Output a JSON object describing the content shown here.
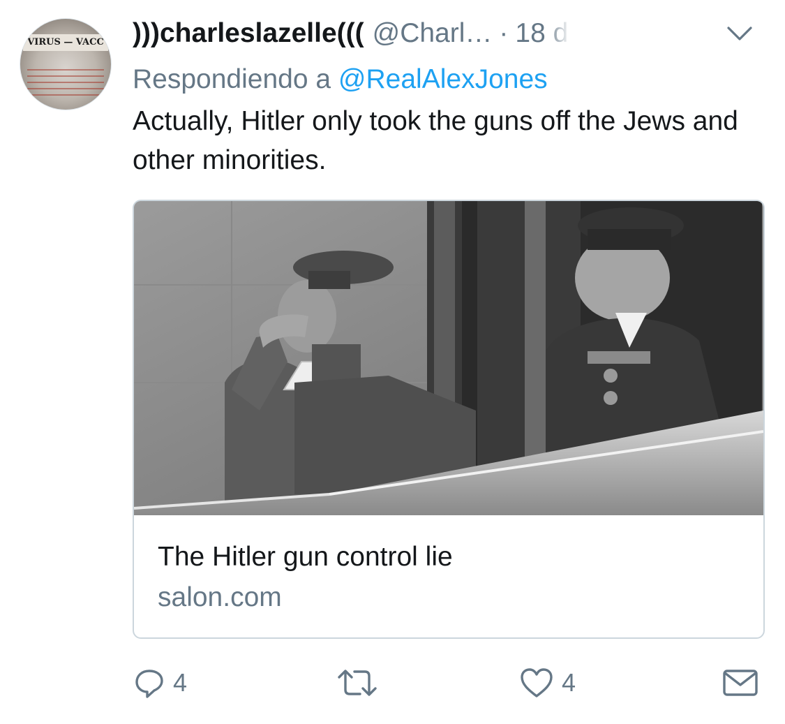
{
  "tweet": {
    "display_name": ")))charleslazelle(((",
    "handle": "@Charl…",
    "dot": "·",
    "time": "18 d",
    "reply_prefix": "Respondiendo a",
    "reply_mention": "@RealAlexJones",
    "text": "Actually, Hitler only took the guns off the Jews and other minorities."
  },
  "avatar": {
    "banner_text": "VIRUS — VACC"
  },
  "card": {
    "title": "The Hitler gun control lie",
    "domain": "salon.com"
  },
  "actions": {
    "reply_count": "4",
    "retweet_count": "",
    "like_count": "4"
  },
  "icons": {
    "chevron": "chevron-down-icon",
    "reply": "reply-icon",
    "retweet": "retweet-icon",
    "like": "heart-icon",
    "dm": "mail-icon"
  },
  "colors": {
    "text": "#14171a",
    "muted": "#657786",
    "link": "#1da1f2",
    "border": "#ccd6dd"
  }
}
